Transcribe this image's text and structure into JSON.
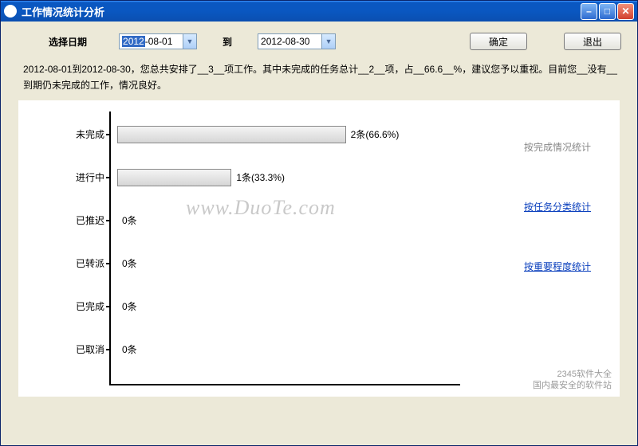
{
  "window": {
    "title": "工作情况统计分析"
  },
  "toolbar": {
    "date_label": "选择日期",
    "start_date": "2012-08-01",
    "start_sel": "2012",
    "start_rest": "-08-01",
    "to_label": "到",
    "end_date": "2012-08-30",
    "confirm": "确定",
    "exit": "退出"
  },
  "summary": "2012-08-01到2012-08-30，您总共安排了__3__项工作。其中未完成的任务总计__2__项，占__66.6__%，建议您予以重视。目前您__没有__到期仍未完成的工作，情况良好。",
  "links": {
    "by_status": "按完成情况统计",
    "by_type": "按任务分类统计",
    "by_priority": "按重要程度统计"
  },
  "watermark": "www.DuoTe.com",
  "footer": {
    "line1": "2345软件大全",
    "line2": "国内最安全的软件站"
  },
  "chart_data": {
    "type": "bar",
    "orientation": "horizontal",
    "title": "",
    "xlabel": "",
    "ylabel": "",
    "xlim": [
      0,
      3
    ],
    "categories": [
      "未完成",
      "进行中",
      "已推迟",
      "已转派",
      "已完成",
      "已取消"
    ],
    "values": [
      2,
      1,
      0,
      0,
      0,
      0
    ],
    "labels": [
      "2条(66.6%)",
      "1条(33.3%)",
      "0条",
      "0条",
      "0条",
      "0条"
    ],
    "total": 3
  }
}
